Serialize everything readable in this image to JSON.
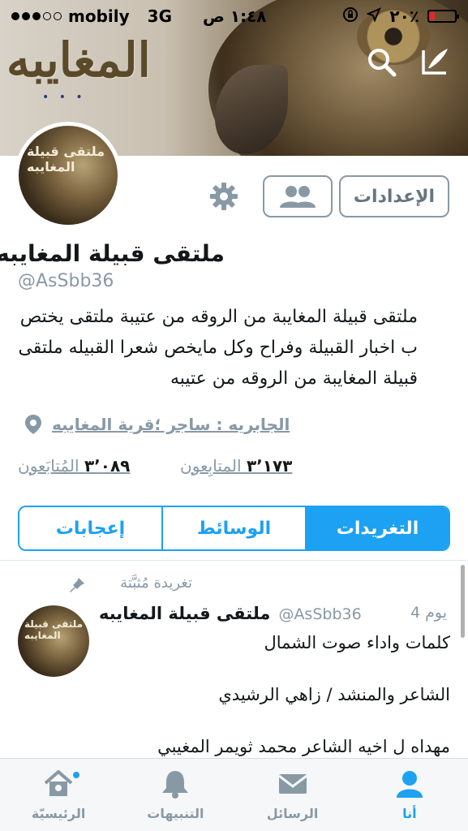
{
  "status_bar": {
    "carrier": "mobily",
    "network": "3G",
    "time": "١:٤٨ ص",
    "battery": "٢٠٪",
    "battery_level": 0.2
  },
  "banner": {
    "logo_text": "المغايبه",
    "dots": "• • •"
  },
  "profile": {
    "avatar_text": "ملتقى قبيلة المغايبه",
    "settings_label": "الإعدادات",
    "name": "ملتقى قبيلة المغايبه",
    "handle": "@AsSbb36",
    "bio": "ملتقى قبيلة المغايبة من الروقه من عتيبة ملتقى يختص ب اخبار القبيلة وفراح وكل مايخص شعرا القبيله ملتقى قبيلة المغايبة من الروقه من عتيبه",
    "location": "الجابريه : ساجر ؛قرية المغايبه",
    "following_count": "٣٬١٧٣",
    "following_label": "المتابِعون",
    "followers_count": "٣٬٠٨٩",
    "followers_label": "المُتابَعون"
  },
  "tabs": [
    {
      "label": "إعجابات",
      "active": false
    },
    {
      "label": "الوسائط",
      "active": false
    },
    {
      "label": "التغريدات",
      "active": true
    }
  ],
  "tweet": {
    "pinned_label": "تغريدة مُثبَّتة",
    "avatar_text": "ملتقى قبيلة المغايبه",
    "name": "ملتقى قبيلة المغايبه",
    "handle": "@AsSbb36",
    "time": "4 يوم",
    "text": "كلمات واداء صوت الشمال\n\nالشاعر والمنشد / زاهي الرشيدي\n\nمهداه ل اخيه الشاعر محمد ثويمر المغيبي"
  },
  "bottom_nav": [
    {
      "label": "الرئيسيّة",
      "icon": "home-icon",
      "badge": true
    },
    {
      "label": "التنبيهات",
      "icon": "bell-icon"
    },
    {
      "label": "الرسائل",
      "icon": "envelope-icon"
    },
    {
      "label": "أنا",
      "icon": "person-icon",
      "active": true
    }
  ],
  "colors": {
    "accent": "#1da1f2",
    "muted": "#8899a6"
  }
}
